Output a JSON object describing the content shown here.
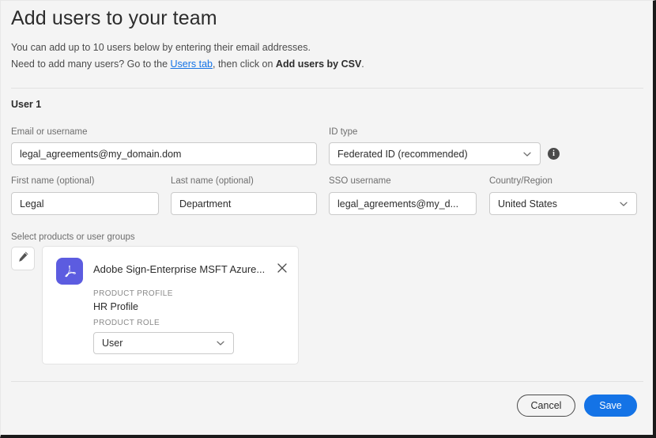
{
  "header": {
    "title": "Add users to your team",
    "subtitle_line1": "You can add up to 10 users below by entering their email addresses.",
    "subtitle_line2_pre": "Need to add many users? Go to the ",
    "subtitle_link": "Users tab",
    "subtitle_line2_mid": ", then click on ",
    "subtitle_line2_bold": "Add users by CSV",
    "subtitle_line2_post": "."
  },
  "form": {
    "user_heading": "User 1",
    "email_label": "Email or username",
    "email_value": "legal_agreements@my_domain.dom",
    "id_type_label": "ID type",
    "id_type_value": "Federated ID (recommended)",
    "info_glyph": "i",
    "first_name_label": "First name (optional)",
    "first_name_value": "Legal",
    "last_name_label": "Last name (optional)",
    "last_name_value": "Department",
    "sso_label": "SSO username",
    "sso_value": "legal_agreements@my_d...",
    "country_label": "Country/Region",
    "country_value": "United States",
    "products_label": "Select products or user groups"
  },
  "product_card": {
    "name": "Adobe Sign-Enterprise MSFT Azure...",
    "profile_label": "PRODUCT PROFILE",
    "profile_value": "HR Profile",
    "role_label": "PRODUCT ROLE",
    "role_value": "User"
  },
  "footer": {
    "cancel_label": "Cancel",
    "save_label": "Save"
  },
  "colors": {
    "accent_blue": "#1473e6",
    "product_purple": "#5c5ce0",
    "background": "#f4f4f4"
  }
}
